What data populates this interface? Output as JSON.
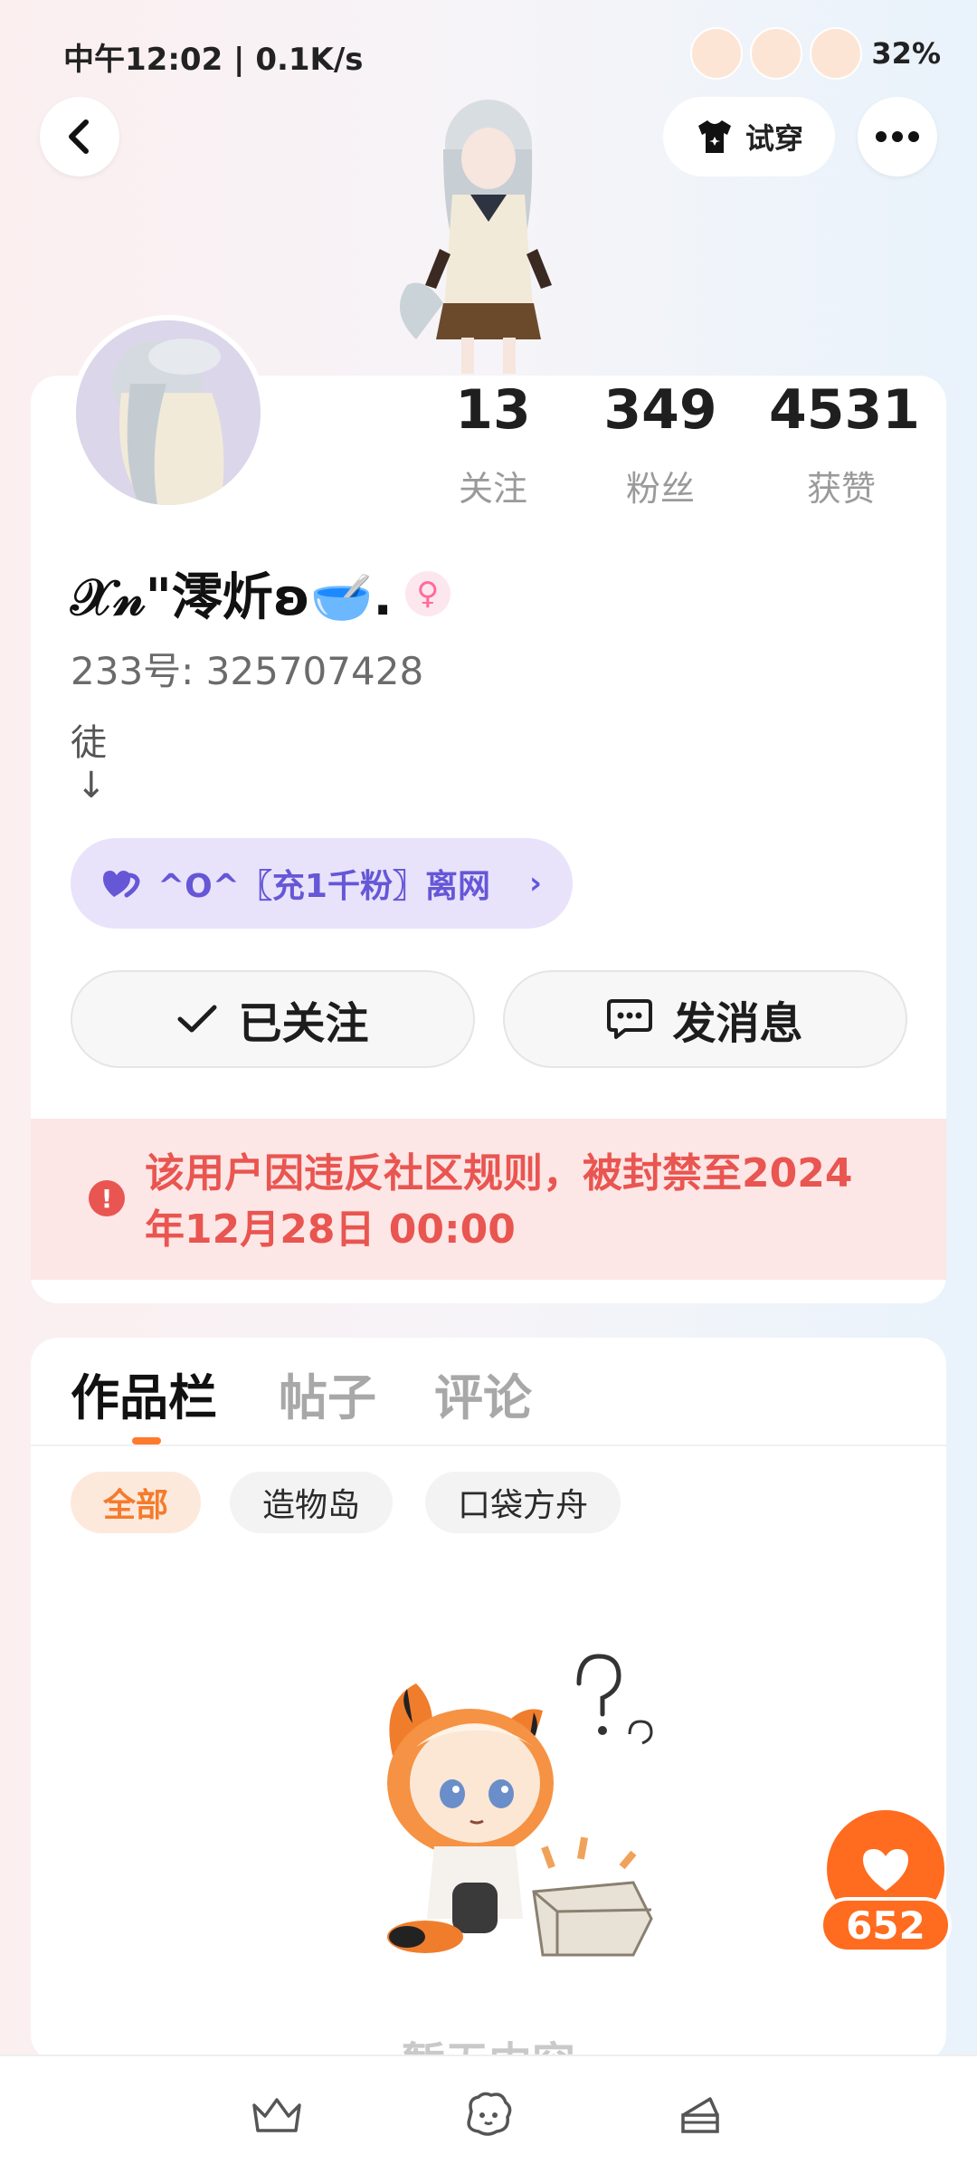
{
  "status_bar": {
    "time_net": "中午12:02 | 0.1K/s",
    "battery": "32%"
  },
  "header": {
    "tryon_label": "试穿"
  },
  "profile": {
    "stats": [
      {
        "value": "13",
        "label": "关注"
      },
      {
        "value": "349",
        "label": "粉丝"
      },
      {
        "value": "4531",
        "label": "获赞"
      }
    ],
    "username": "𝒳𝓃\"澪炘ʚ🥣.",
    "uid": "233号: 325707428",
    "bio_line1": "徒",
    "bio_line2": "↓",
    "group": "^O^〖充1千粉〗离网",
    "follow_label": "已关注",
    "message_label": "发消息",
    "ban_notice": "该用户因违反社区规则，被封禁至2024年12月28日 00:00"
  },
  "works": {
    "tabs": [
      "作品栏",
      "帖子",
      "评论"
    ],
    "filters": [
      "全部",
      "造物岛",
      "口袋方舟"
    ],
    "empty_text": "暂无内容",
    "like_count": "652"
  },
  "colors": {
    "accent": "#ff6b1f",
    "ban": "#e95550",
    "group": "#6557d6"
  }
}
